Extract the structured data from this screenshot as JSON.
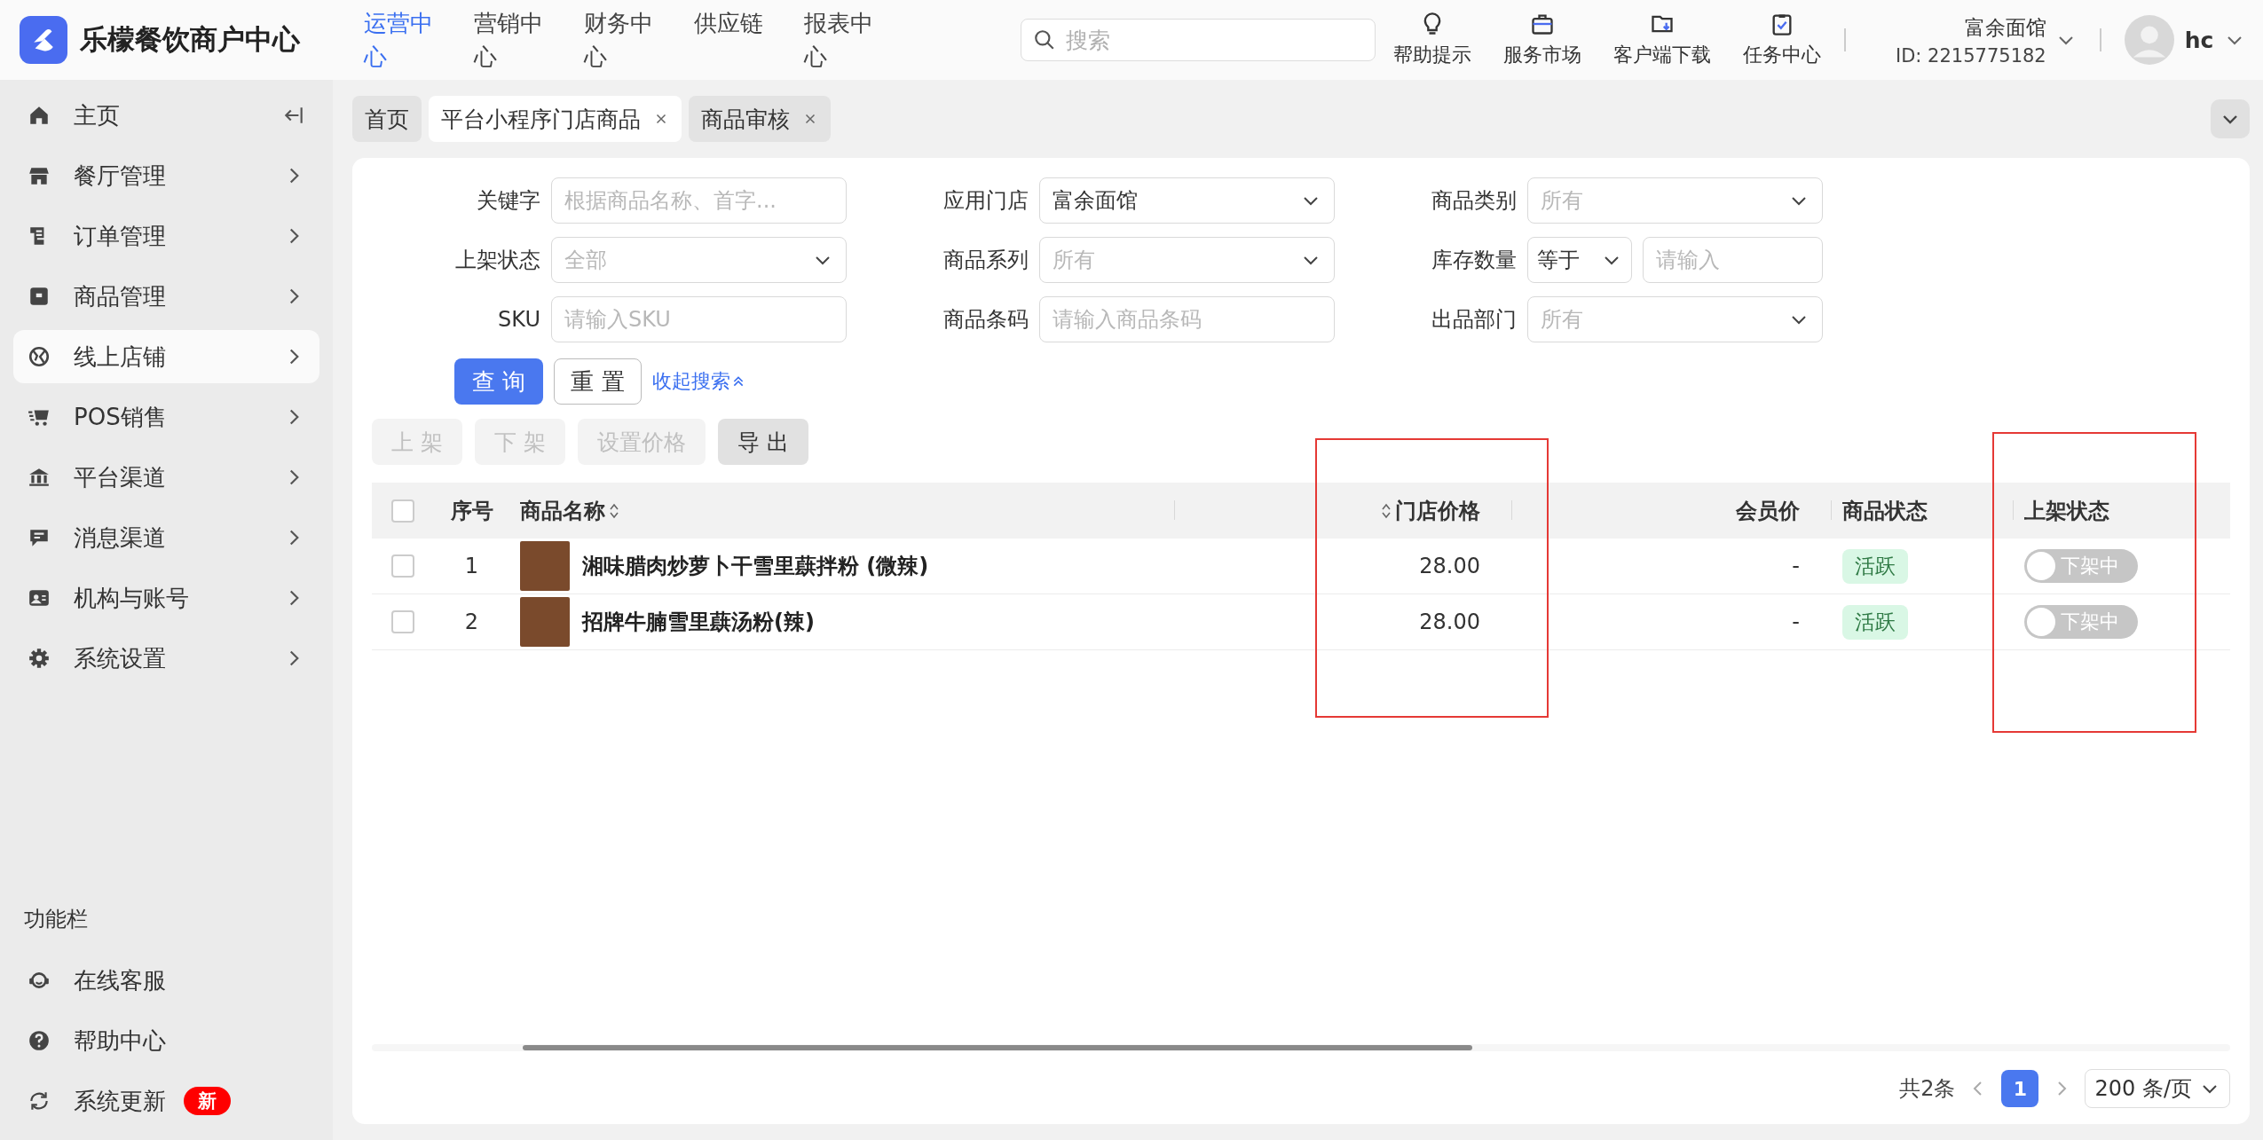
{
  "app": {
    "name": "乐檬餐饮商户中心"
  },
  "top_nav": [
    {
      "label": "运营中心",
      "selected": true
    },
    {
      "label": "营销中心",
      "selected": false
    },
    {
      "label": "财务中心",
      "selected": false
    },
    {
      "label": "供应链",
      "selected": false
    },
    {
      "label": "报表中心",
      "selected": false
    }
  ],
  "search": {
    "placeholder": "搜索"
  },
  "toolbar": [
    {
      "label": "帮助提示",
      "kind": "tips"
    },
    {
      "label": "服务市场",
      "kind": "market"
    },
    {
      "label": "客户端下载",
      "kind": "download"
    },
    {
      "label": "任务中心",
      "kind": "tasks"
    }
  ],
  "store": {
    "name": "富余面馆",
    "id": "ID: 2215775182"
  },
  "user": {
    "name": "hc"
  },
  "sidebar": {
    "items": [
      {
        "label": "主页",
        "kind": "home",
        "selected": false
      },
      {
        "label": "餐厅管理",
        "kind": "restaurant",
        "selected": false
      },
      {
        "label": "订单管理",
        "kind": "order",
        "selected": false
      },
      {
        "label": "商品管理",
        "kind": "goods",
        "selected": false
      },
      {
        "label": "线上店铺",
        "kind": "online",
        "selected": true
      },
      {
        "label": "POS销售",
        "kind": "pos",
        "selected": false
      },
      {
        "label": "平台渠道",
        "kind": "platform",
        "selected": false
      },
      {
        "label": "消息渠道",
        "kind": "message",
        "selected": false
      },
      {
        "label": "机构与账号",
        "kind": "org",
        "selected": false
      },
      {
        "label": "系统设置",
        "kind": "settings",
        "selected": false
      }
    ],
    "function_bar": {
      "title": "功能栏",
      "items": [
        {
          "label": "在线客服",
          "kind": "support"
        },
        {
          "label": "帮助中心",
          "kind": "help"
        },
        {
          "label": "系统更新",
          "kind": "update",
          "badge": "新"
        }
      ]
    }
  },
  "tabs": [
    {
      "label": "首页",
      "selected": false,
      "closable": false
    },
    {
      "label": "平台小程序门店商品",
      "selected": true,
      "closable": true
    },
    {
      "label": "商品审核",
      "selected": false,
      "closable": true
    }
  ],
  "filters": [
    {
      "label": "关键字",
      "kind": "input",
      "placeholder": "根据商品名称、首字..."
    },
    {
      "label": "应用门店",
      "kind": "select",
      "value": "富余面馆"
    },
    {
      "label": "商品类别",
      "kind": "select",
      "placeholder": "所有"
    },
    {
      "label": "上架状态",
      "kind": "select",
      "placeholder": "全部"
    },
    {
      "label": "商品系列",
      "kind": "select",
      "placeholder": "所有"
    },
    {
      "label": "库存数量",
      "kind": "compare",
      "operator": "等于",
      "placeholder": "请输入"
    },
    {
      "label": "SKU",
      "kind": "input",
      "placeholder": "请输入SKU"
    },
    {
      "label": "商品条码",
      "kind": "input",
      "placeholder": "请输入商品条码"
    },
    {
      "label": "出品部门",
      "kind": "select",
      "placeholder": "所有"
    }
  ],
  "search_buttons": {
    "query": "查 询",
    "reset": "重 置",
    "collapse": "收起搜索"
  },
  "actions": [
    {
      "label": "上 架",
      "disabled": true
    },
    {
      "label": "下 架",
      "disabled": true
    },
    {
      "label": "设置价格",
      "disabled": true
    },
    {
      "label": "导 出",
      "disabled": false
    }
  ],
  "table": {
    "all_checked": false,
    "columns": [
      {
        "label": "序号",
        "sortable": false
      },
      {
        "label": "商品名称",
        "sortable": true
      },
      {
        "label": "门店价格",
        "sortable": true
      },
      {
        "label": "会员价",
        "sortable": false
      },
      {
        "label": "商品状态",
        "sortable": false
      },
      {
        "label": "上架状态",
        "sortable": false
      }
    ],
    "rows": [
      {
        "checked": false,
        "index": "1",
        "name": "湘味腊肉炒萝卜干雪里蕻拌粉 (微辣)",
        "price": "28.00",
        "member_price": "-",
        "status": "活跃",
        "on_shelf": false,
        "shelf_label": "下架中"
      },
      {
        "checked": false,
        "index": "2",
        "name": "招牌牛腩雪里蕻汤粉(辣)",
        "price": "28.00",
        "member_price": "-",
        "status": "活跃",
        "on_shelf": false,
        "shelf_label": "下架中"
      }
    ]
  },
  "pagination": {
    "total": "共2条",
    "pages": [
      {
        "label": "1",
        "selected": true
      }
    ],
    "page_size": "200 条/页"
  }
}
